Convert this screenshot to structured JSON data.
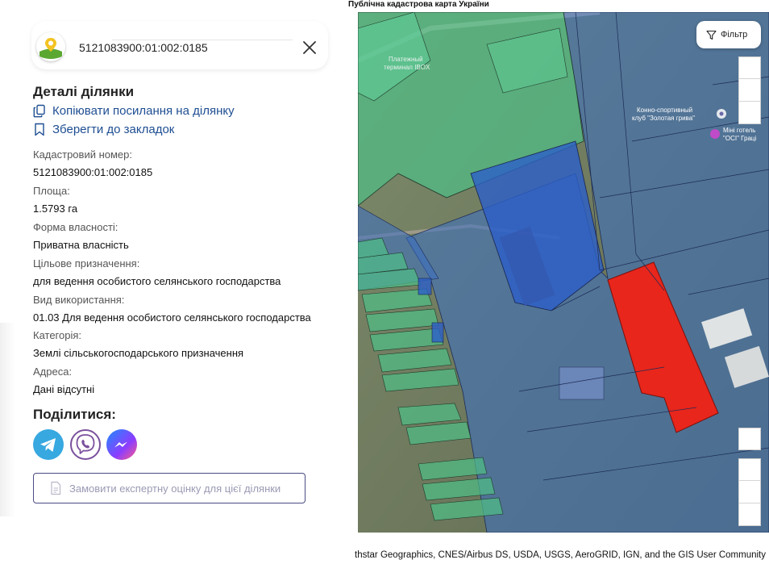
{
  "app": {
    "title": "Публічна кадастрова карта України"
  },
  "search": {
    "value": "5121083900:01:002:0185"
  },
  "details": {
    "title": "Деталі ділянки",
    "copy_link": "Копіювати посилання на ділянку",
    "bookmark": "Зберегти до закладок",
    "fields": [
      {
        "label": "Кадастровий номер:",
        "value": "5121083900:01:002:0185"
      },
      {
        "label": "Площа:",
        "value": "1.5793 га"
      },
      {
        "label": "Форма власності:",
        "value": "Приватна власність"
      },
      {
        "label": "Цільове призначення:",
        "value": "для ведення особистого селянського господарства"
      },
      {
        "label": "Вид використання:",
        "value": "01.03 Для ведення особистого селянського господарства"
      },
      {
        "label": "Категорія:",
        "value": "Землі сільськогосподарського призначення"
      },
      {
        "label": "Адреса:",
        "value": "Дані відсутні"
      }
    ]
  },
  "share": {
    "title": "Поділитися:",
    "services": [
      "telegram",
      "viber",
      "messenger"
    ]
  },
  "order_button": {
    "label": "Замовити експертну оцінку для цієї ділянки"
  },
  "map": {
    "filter_label": "Фільтр",
    "labels": {
      "terminal_line1": "Платежный",
      "terminal_line2": "терминал IBOX",
      "club_line1": "Конно-спортивный",
      "club_line2": "клуб \"Золотая грива\"",
      "hotel_line1": "Міні готель",
      "hotel_line2": "\"ОСІ\" Граці"
    },
    "attribution": "thstar Geographics, CNES/Airbus DS, USDA, USGS, AeroGRID, IGN, and the GIS User Community",
    "colors": {
      "selected_parcel": "#e8261c",
      "green_parcel": "#4fbf86",
      "blue_parcel": "#3a6fc4",
      "dark_blue_parcel": "#2c5fc9"
    }
  }
}
